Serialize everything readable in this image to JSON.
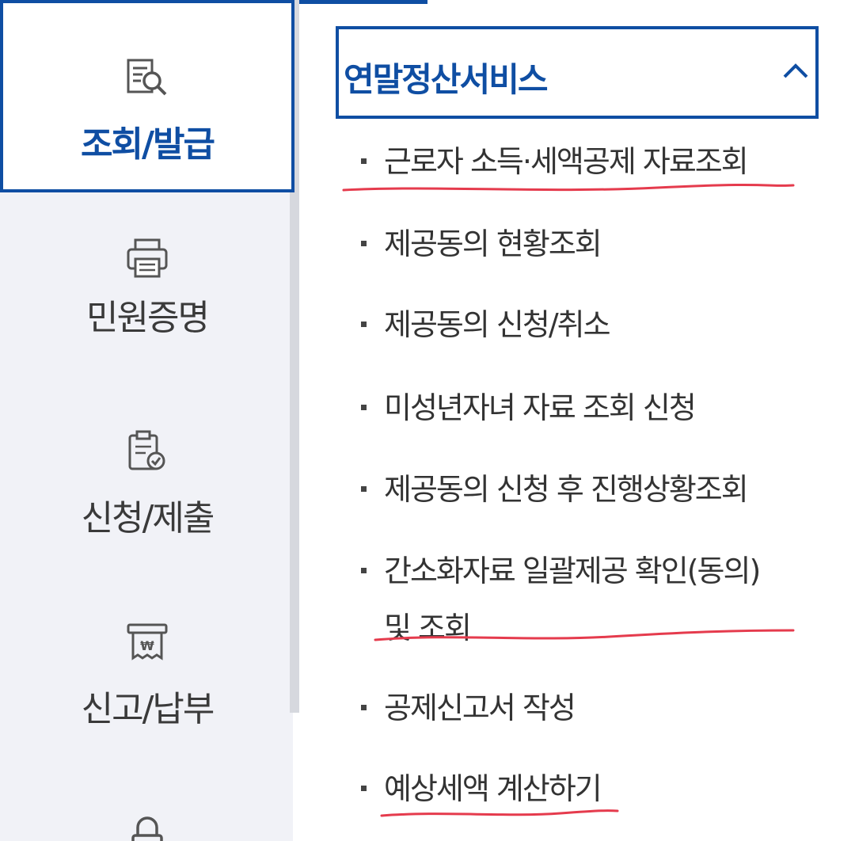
{
  "sidebar": {
    "items": [
      {
        "label": "조회/발급",
        "icon": "document-search-icon",
        "active": true
      },
      {
        "label": "민원증명",
        "icon": "printer-icon",
        "active": false
      },
      {
        "label": "신청/제출",
        "icon": "clipboard-check-icon",
        "active": false
      },
      {
        "label": "신고/납부",
        "icon": "won-receipt-icon",
        "active": false
      },
      {
        "label": "",
        "icon": "lock-icon",
        "active": false
      }
    ]
  },
  "panel": {
    "title": "연말정산서비스",
    "expanded": true,
    "chevron_icon": "chevron-up-icon",
    "items": [
      {
        "label": "근로자 소득·세액공제 자료조회",
        "underlined": true
      },
      {
        "label": "제공동의 현황조회",
        "underlined": false
      },
      {
        "label": "제공동의 신청/취소",
        "underlined": false
      },
      {
        "label": "미성년자녀 자료 조회 신청",
        "underlined": false
      },
      {
        "label": "제공동의 신청 후 진행상황조회",
        "underlined": false
      },
      {
        "label": "간소화자료 일괄제공 확인(동의) 및 조회",
        "underlined": true
      },
      {
        "label": "공제신고서 작성",
        "underlined": false
      },
      {
        "label": "예상세액 계산하기",
        "underlined": true
      }
    ]
  },
  "colors": {
    "accent": "#0f4ea3",
    "sidebar_bg": "#f1f2f7",
    "text": "#333333",
    "annotation_underline": "#e53b4d"
  }
}
